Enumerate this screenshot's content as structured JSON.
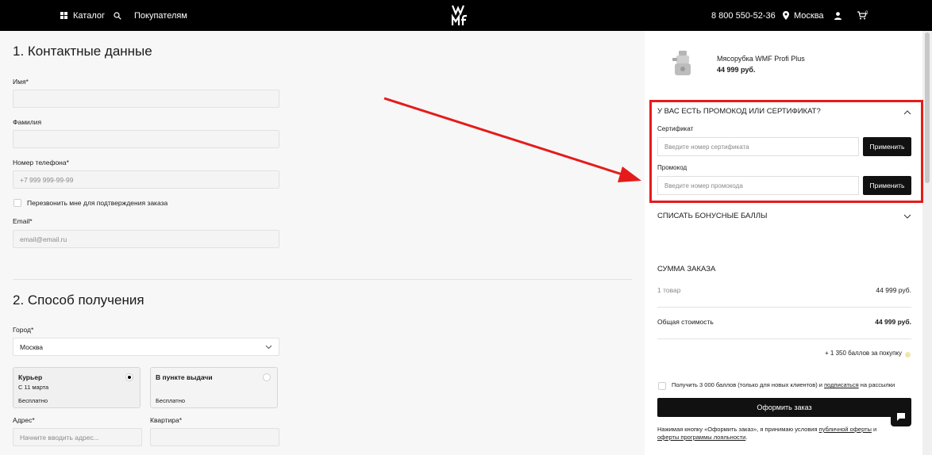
{
  "header": {
    "catalog_label": "Каталог",
    "customers_label": "Покупателям",
    "phone": "8 800 550-52-36",
    "city": "Москва",
    "icons": [
      "grid-icon",
      "search-icon",
      "location-icon",
      "user-icon",
      "cart-icon"
    ],
    "cart_count": "0"
  },
  "contact": {
    "title": "1. Контактные данные",
    "first_name_label": "Имя*",
    "first_name_value": "",
    "last_name_label": "Фамилия",
    "last_name_value": "",
    "phone_label": "Номер телефона*",
    "phone_placeholder": "+7 999 999-99-99",
    "callback_label": "Перезвонить мне для подтверждения заказа",
    "email_label": "Email*",
    "email_placeholder": "email@email.ru"
  },
  "delivery": {
    "title": "2. Способ получения",
    "city_label": "Город*",
    "city_value": "Москва",
    "options": [
      {
        "title": "Курьер",
        "subtitle": "С 11 марта",
        "price": "Бесплатно",
        "selected": true
      },
      {
        "title": "В пункте выдачи",
        "subtitle": "",
        "price": "Бесплатно",
        "selected": false
      }
    ],
    "address_label": "Адрес*",
    "address_placeholder": "Начните вводить адрес...",
    "apartment_label": "Квартира*",
    "apartment_value": ""
  },
  "cart": {
    "product_name": "Мясорубка WMF Profi Plus",
    "product_price": "44 999 руб."
  },
  "promo": {
    "title": "У ВАС ЕСТЬ ПРОМОКОД ИЛИ СЕРТИФИКАТ?",
    "certificate_label": "Сертификат",
    "certificate_placeholder": "Введите номер сертификата",
    "apply_label": "Применить",
    "promocode_label": "Промокод",
    "promocode_placeholder": "Введите номер промокода",
    "highlight_color": "#e51b1b"
  },
  "bonus": {
    "title": "СПИСАТЬ БОНУСНЫЕ БАЛЛЫ"
  },
  "summary": {
    "title": "СУММА ЗАКАЗА",
    "items_label": "1 товар",
    "items_value": "44 999 руб.",
    "total_label": "Общая стоимость",
    "total_value": "44 999 руб.",
    "bonus_points": "+ 1 350 баллов за покупку",
    "subscribe_prefix": "Получить 3 000 баллов (только для новых клиентов) и ",
    "subscribe_link": "подписаться",
    "subscribe_suffix": " на рассылки",
    "checkout_label": "Оформить заказ",
    "legal_prefix": "Нажимая кнопку «Оформить заказ», я принимаю условия ",
    "legal_link1": "публичной оферты",
    "legal_mid": " и ",
    "legal_link2": "оферты программы лояльности",
    "legal_suffix": "."
  }
}
